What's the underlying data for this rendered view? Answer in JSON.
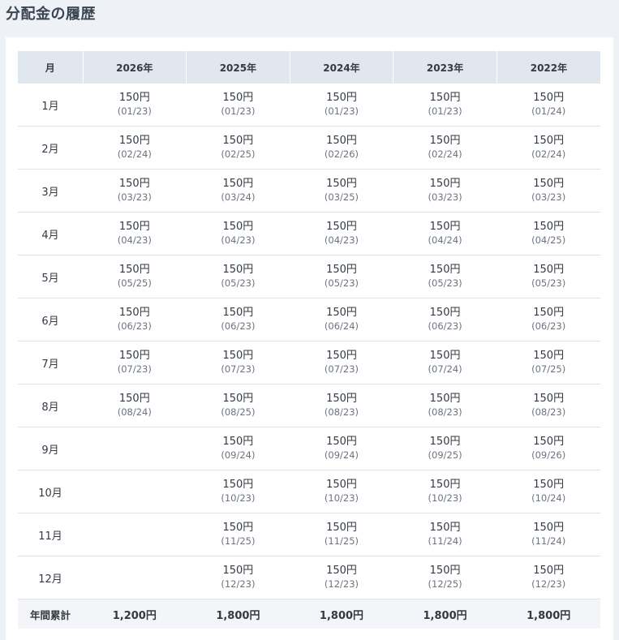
{
  "page": {
    "title": "分配金の履歴"
  },
  "table": {
    "headers": [
      "月",
      "2026年",
      "2025年",
      "2024年",
      "2023年",
      "2022年"
    ],
    "rows": [
      {
        "month": "1月",
        "cells": [
          {
            "amount": "150円",
            "date": "(01/23)"
          },
          {
            "amount": "150円",
            "date": "(01/23)"
          },
          {
            "amount": "150円",
            "date": "(01/23)"
          },
          {
            "amount": "150円",
            "date": "(01/23)"
          },
          {
            "amount": "150円",
            "date": "(01/24)"
          }
        ]
      },
      {
        "month": "2月",
        "cells": [
          {
            "amount": "150円",
            "date": "(02/24)"
          },
          {
            "amount": "150円",
            "date": "(02/25)"
          },
          {
            "amount": "150円",
            "date": "(02/26)"
          },
          {
            "amount": "150円",
            "date": "(02/24)"
          },
          {
            "amount": "150円",
            "date": "(02/24)"
          }
        ]
      },
      {
        "month": "3月",
        "cells": [
          {
            "amount": "150円",
            "date": "(03/23)"
          },
          {
            "amount": "150円",
            "date": "(03/24)"
          },
          {
            "amount": "150円",
            "date": "(03/25)"
          },
          {
            "amount": "150円",
            "date": "(03/23)"
          },
          {
            "amount": "150円",
            "date": "(03/23)"
          }
        ]
      },
      {
        "month": "4月",
        "cells": [
          {
            "amount": "150円",
            "date": "(04/23)"
          },
          {
            "amount": "150円",
            "date": "(04/23)"
          },
          {
            "amount": "150円",
            "date": "(04/23)"
          },
          {
            "amount": "150円",
            "date": "(04/24)"
          },
          {
            "amount": "150円",
            "date": "(04/25)"
          }
        ]
      },
      {
        "month": "5月",
        "cells": [
          {
            "amount": "150円",
            "date": "(05/25)"
          },
          {
            "amount": "150円",
            "date": "(05/23)"
          },
          {
            "amount": "150円",
            "date": "(05/23)"
          },
          {
            "amount": "150円",
            "date": "(05/23)"
          },
          {
            "amount": "150円",
            "date": "(05/23)"
          }
        ]
      },
      {
        "month": "6月",
        "cells": [
          {
            "amount": "150円",
            "date": "(06/23)"
          },
          {
            "amount": "150円",
            "date": "(06/23)"
          },
          {
            "amount": "150円",
            "date": "(06/24)"
          },
          {
            "amount": "150円",
            "date": "(06/23)"
          },
          {
            "amount": "150円",
            "date": "(06/23)"
          }
        ]
      },
      {
        "month": "7月",
        "cells": [
          {
            "amount": "150円",
            "date": "(07/23)"
          },
          {
            "amount": "150円",
            "date": "(07/23)"
          },
          {
            "amount": "150円",
            "date": "(07/23)"
          },
          {
            "amount": "150円",
            "date": "(07/24)"
          },
          {
            "amount": "150円",
            "date": "(07/25)"
          }
        ]
      },
      {
        "month": "8月",
        "cells": [
          {
            "amount": "150円",
            "date": "(08/24)"
          },
          {
            "amount": "150円",
            "date": "(08/25)"
          },
          {
            "amount": "150円",
            "date": "(08/23)"
          },
          {
            "amount": "150円",
            "date": "(08/23)"
          },
          {
            "amount": "150円",
            "date": "(08/23)"
          }
        ]
      },
      {
        "month": "9月",
        "cells": [
          {
            "amount": "",
            "date": ""
          },
          {
            "amount": "150円",
            "date": "(09/24)"
          },
          {
            "amount": "150円",
            "date": "(09/24)"
          },
          {
            "amount": "150円",
            "date": "(09/25)"
          },
          {
            "amount": "150円",
            "date": "(09/26)"
          }
        ]
      },
      {
        "month": "10月",
        "cells": [
          {
            "amount": "",
            "date": ""
          },
          {
            "amount": "150円",
            "date": "(10/23)"
          },
          {
            "amount": "150円",
            "date": "(10/23)"
          },
          {
            "amount": "150円",
            "date": "(10/23)"
          },
          {
            "amount": "150円",
            "date": "(10/24)"
          }
        ]
      },
      {
        "month": "11月",
        "cells": [
          {
            "amount": "",
            "date": ""
          },
          {
            "amount": "150円",
            "date": "(11/25)"
          },
          {
            "amount": "150円",
            "date": "(11/25)"
          },
          {
            "amount": "150円",
            "date": "(11/24)"
          },
          {
            "amount": "150円",
            "date": "(11/24)"
          }
        ]
      },
      {
        "month": "12月",
        "cells": [
          {
            "amount": "",
            "date": ""
          },
          {
            "amount": "150円",
            "date": "(12/23)"
          },
          {
            "amount": "150円",
            "date": "(12/23)"
          },
          {
            "amount": "150円",
            "date": "(12/25)"
          },
          {
            "amount": "150円",
            "date": "(12/23)"
          }
        ]
      }
    ],
    "totals": {
      "label": "年間累計",
      "values": [
        "1,200円",
        "1,800円",
        "1,800円",
        "1,800円",
        "1,800円"
      ]
    }
  },
  "colors": {
    "page_background": "#eef1f5",
    "header_background": "#e1e7ef",
    "totals_background": "#f3f5f8",
    "row_divider": "#dfe3e8"
  }
}
